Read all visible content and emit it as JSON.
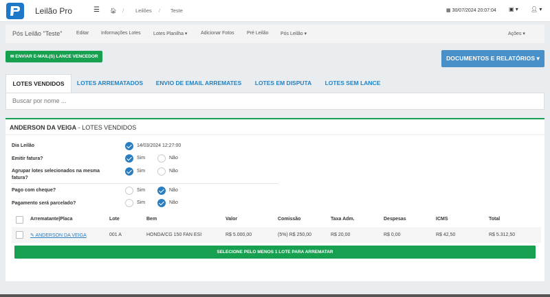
{
  "header": {
    "app_title": "Leilão Pro",
    "breadcrumb": [
      "Leilões",
      "Teste"
    ],
    "datetime": "30/07/2024 20:07:04"
  },
  "subnav": {
    "title": "Pós Leilão \"Teste\"",
    "items": [
      "Editar",
      "Informações Lotes",
      "Lotes Planilha ▾",
      "Adicionar Fotos",
      "Pré Leilão",
      "Pós Leilão ▾"
    ],
    "actions": "Ações ▾"
  },
  "buttons": {
    "email": "ENVIAR E-MAIL(S) LANCE VENCEDOR",
    "docs": "DOCUMENTOS E RELATÓRIOS ▾",
    "select_lot": "SELECIONE PELO MENOS 1 LOTE PARA ARREMATAR"
  },
  "tabs": [
    "LOTES VENDIDOS",
    "LOTES ARREMATADOS",
    "ENVIO DE EMAIL ARREMATES",
    "LOTES EM DISPUTA",
    "LOTES SEM LANCE"
  ],
  "search": {
    "placeholder": "Buscar por nome ..."
  },
  "panel": {
    "title_name": "ANDERSON DA VEIGA",
    "title_suffix": " - LOTES VENDIDOS"
  },
  "form": {
    "dia_leilao_label": "Dia Leilão",
    "dia_leilao_value": "14/03/2024 12:27:00",
    "emitir_fatura_label": "Emitir fatura?",
    "agrupar_label": "Agrupar lotes selecionados na mesma fatura?",
    "pago_cheque_label": "Pago com cheque?",
    "parcelado_label": "Pagamento será parcelado?",
    "sim": "Sim",
    "nao": "Não"
  },
  "table": {
    "headers": [
      "Arrematante|Placa",
      "Lote",
      "Bem",
      "Valor",
      "Comissão",
      "Taxa Adm.",
      "Despesas",
      "ICMS",
      "Total"
    ],
    "rows": [
      [
        "ANDERSON DA VEIGA",
        "001 A",
        "HONDA/CG 150 FAN ESI",
        "R$ 5.000,00",
        "(5%) R$ 250,00",
        "R$ 20,00",
        "R$ 0,00",
        "R$ 42,50",
        "R$ 5.312,50"
      ]
    ]
  },
  "colors": {
    "green": "#16a050",
    "blue": "#4a90c8",
    "link": "#2a7dbf"
  }
}
